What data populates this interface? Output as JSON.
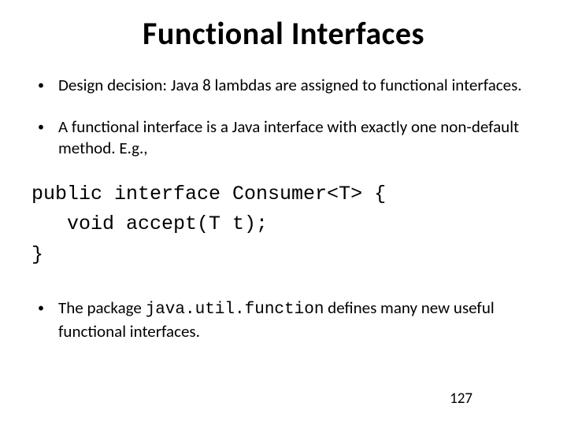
{
  "title": "Functional Interfaces",
  "bullets": {
    "b1": "Design decision: Java 8 lambdas are assigned to functional interfaces.",
    "b2": "A functional interface is a Java interface with exactly one non-default method.  E.g.,"
  },
  "code": "public interface Consumer<T> {\n   void accept(T t);\n}",
  "bullet3": {
    "prefix": "The package ",
    "code": "java.util.function",
    "suffix": " defines many new useful functional interfaces."
  },
  "pageNumber": "127"
}
